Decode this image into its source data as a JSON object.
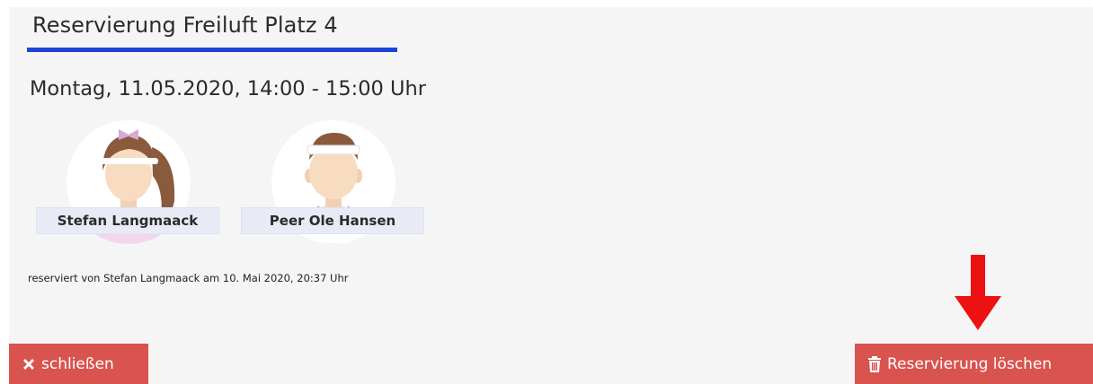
{
  "dialog": {
    "title": "Reservierung Freiluft Platz 4",
    "datetime": "Montag, 11.05.2020, 14:00 - 15:00 Uhr",
    "players": [
      {
        "name": "Stefan Langmaack",
        "avatar": "female-avatar"
      },
      {
        "name": "Peer Ole Hansen",
        "avatar": "male-avatar"
      }
    ],
    "reserved_by": "reserviert von Stefan Langmaack am 10. Mai 2020, 20:37 Uhr"
  },
  "buttons": {
    "close_label": "schließen",
    "close_icon": "close-x-icon",
    "delete_label": "Reservierung löschen",
    "delete_icon": "trash-icon"
  },
  "annotation": {
    "arrow_icon": "down-arrow-icon",
    "arrow_color": "#ee1111"
  },
  "colors": {
    "accent_underline": "#1f45d8",
    "button_danger": "#d9534f",
    "name_plate": "#e8ebf6",
    "background": "#f5f5f5"
  }
}
